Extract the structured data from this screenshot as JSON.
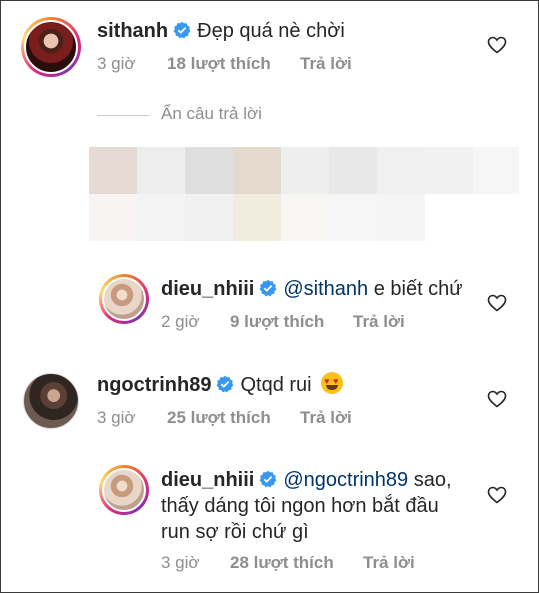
{
  "comments": [
    {
      "username": "sithanh",
      "text": "Đẹp quá nè chời",
      "time": "3 giờ",
      "likes": "18 lượt thích",
      "reply": "Trả lời"
    },
    {
      "username": "dieu_nhiii",
      "mention": "@sithanh",
      "text": "e biết chứ",
      "time": "2 giờ",
      "likes": "9 lượt thích",
      "reply": "Trả lời"
    },
    {
      "username": "ngoctrinh89",
      "text": "Qtqd rui",
      "emoji": "😍",
      "time": "3 giờ",
      "likes": "25 lượt thích",
      "reply": "Trả lời"
    },
    {
      "username": "dieu_nhiii",
      "mention": "@ngoctrinh89",
      "text_line1": "sao,",
      "text_line2": "thấy dáng tôi ngon hơn bắt đầu",
      "text_line3": "run sợ rồi chứ gì",
      "time": "3 giờ",
      "likes": "28 lượt thích",
      "reply": "Trả lời"
    }
  ],
  "hide_replies": "Ẩn câu trả lời",
  "colors": {
    "verified": "#3897f0",
    "mention": "#003569",
    "meta": "#8e8e8e"
  },
  "icons": [
    "verified-icon",
    "heart-icon"
  ]
}
